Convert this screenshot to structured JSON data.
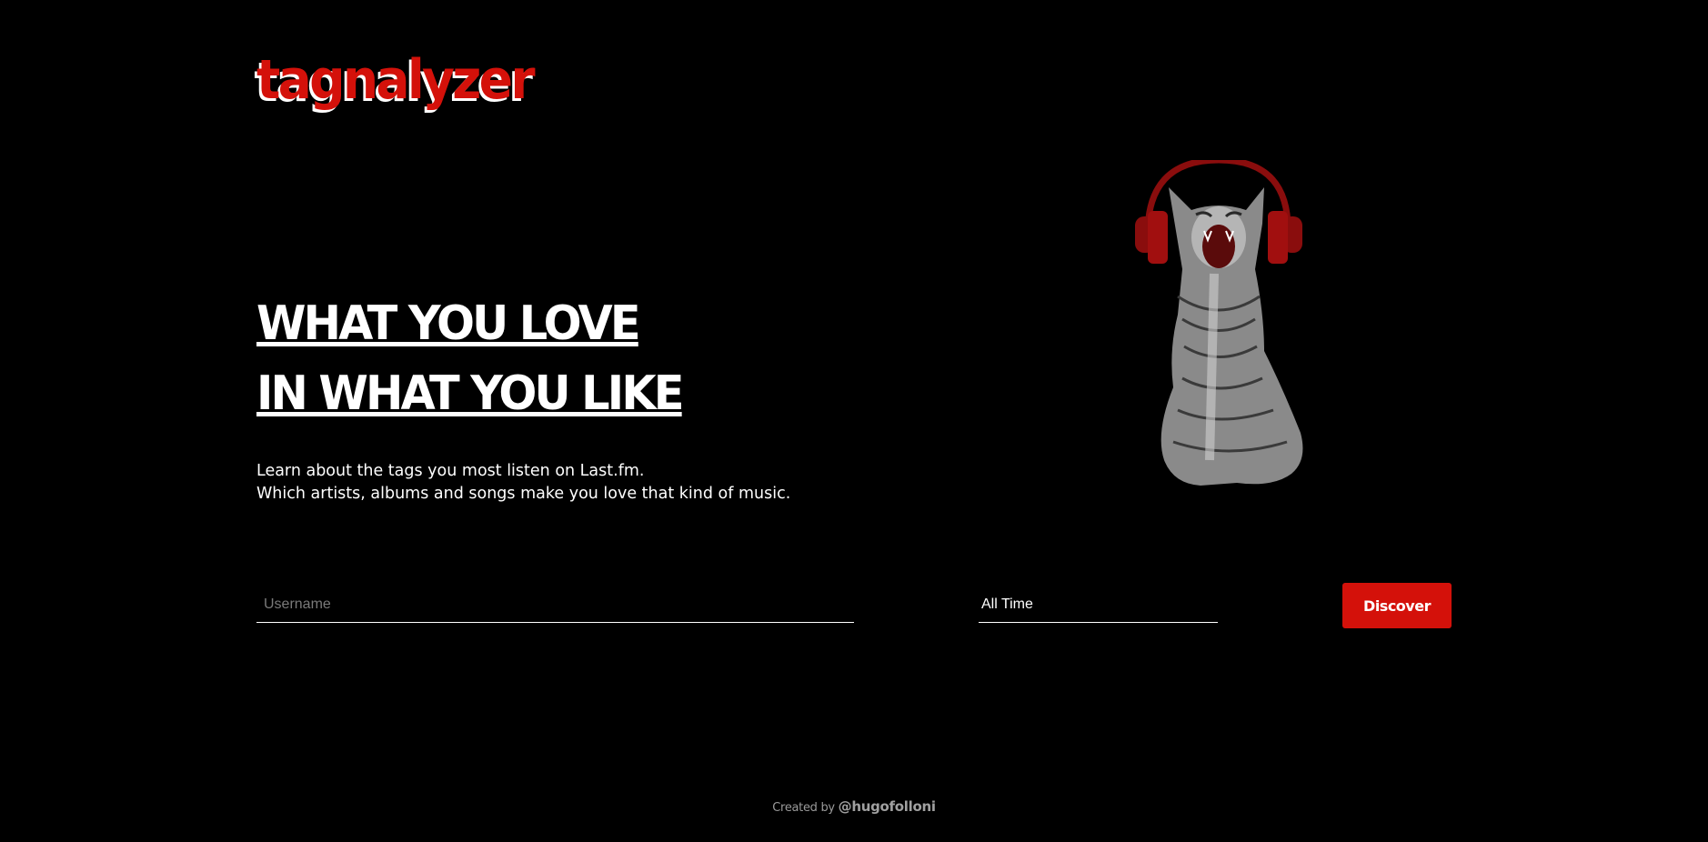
{
  "brand": {
    "logo_text": "tagnalyzer",
    "accent_color": "#d4110a"
  },
  "hero": {
    "headline_line1": "WHAT YOU LOVE",
    "headline_line2": "IN WHAT YOU LIKE",
    "description_line1": "Learn about the tags you most listen on Last.fm.",
    "description_line2": "Which artists, albums and songs make you love that kind of music."
  },
  "illustration": {
    "icon": "cat-with-headphones"
  },
  "form": {
    "username_placeholder": "Username",
    "username_value": "",
    "period_selected": "All Time",
    "discover_label": "Discover"
  },
  "footer": {
    "created_by": "Created by",
    "handle": "@hugofolloni"
  }
}
